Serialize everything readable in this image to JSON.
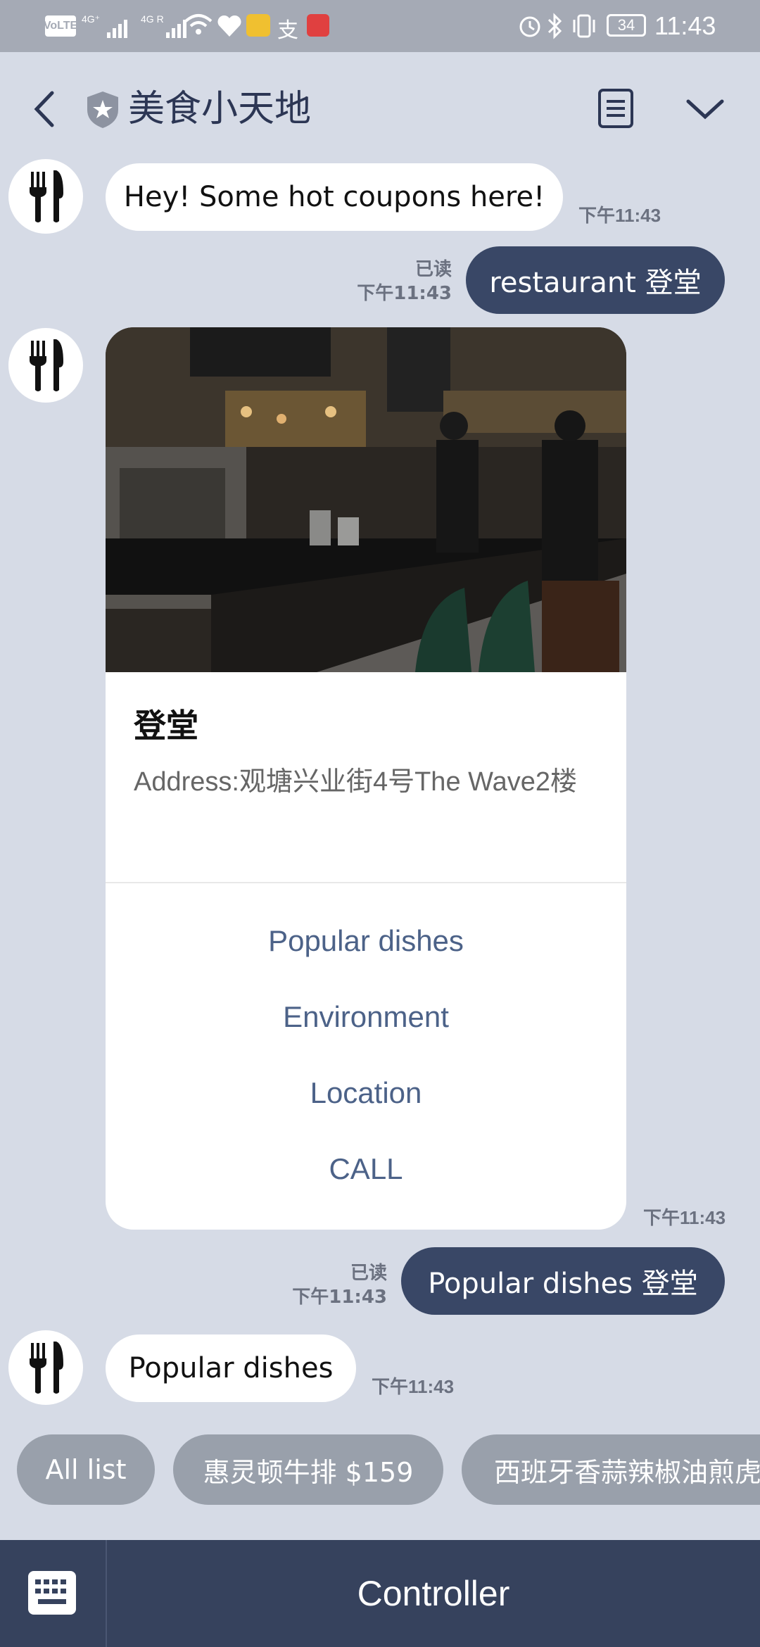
{
  "status_bar": {
    "volte": "VoLTE",
    "sig1": "4G⁺",
    "sig2": "4G R",
    "battery": "34",
    "time": "11:43"
  },
  "header": {
    "title": "美食小天地",
    "back_icon": "chevron-left-icon",
    "shield_icon": "shield-star-icon",
    "menu_icon": "notes-icon",
    "collapse_icon": "chevron-down-icon"
  },
  "messages": [
    {
      "type": "in",
      "text": "Hey! Some hot coupons here!",
      "time": "下午11:43"
    },
    {
      "type": "out",
      "text": "restaurant 登堂",
      "read": "已读",
      "time": "下午11:43"
    },
    {
      "type": "card",
      "time": "下午11:43"
    },
    {
      "type": "out",
      "text": "Popular dishes 登堂",
      "read": "已读",
      "time": "下午11:43"
    },
    {
      "type": "in",
      "text": "Popular dishes",
      "time": "下午11:43"
    }
  ],
  "card": {
    "title": "登堂",
    "address": "Address:观塘兴业街4号The Wave2楼",
    "buttons": [
      "Popular dishes",
      "Environment",
      "Location",
      "CALL"
    ]
  },
  "quick_replies": [
    "All list",
    "惠灵顿牛排 $159",
    "西班牙香蒜辣椒油煎虎"
  ],
  "bottom_bar": {
    "keyboard_icon": "keyboard-icon",
    "controller_label": "Controller"
  },
  "colors": {
    "background": "#d6dbe6",
    "outgoing_bubble": "#394766",
    "card_button_text": "#4c6288",
    "bottom_bar": "#36425d",
    "chip": "#99a0ab"
  }
}
